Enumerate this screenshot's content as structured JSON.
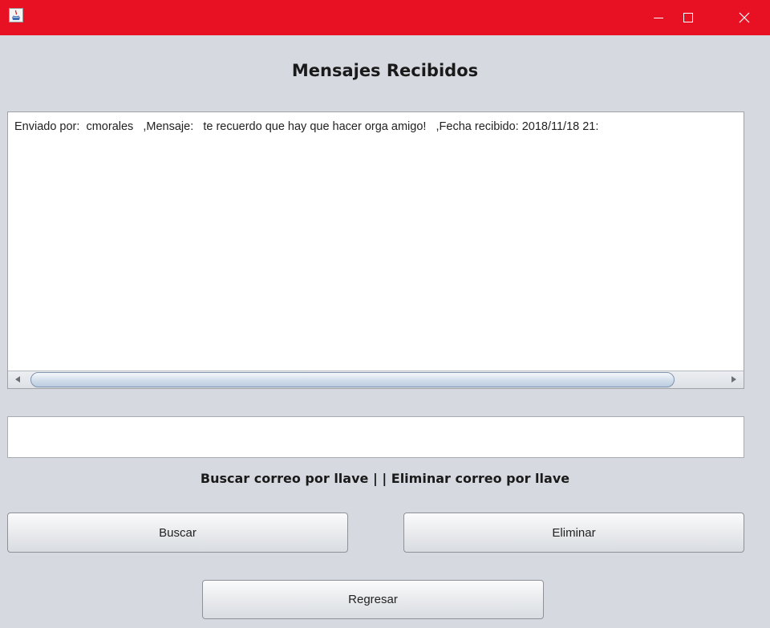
{
  "window": {
    "colors": {
      "titlebar": "#e81123",
      "background": "#d6d9df"
    },
    "icons": {
      "app": "java-icon",
      "minimize": "minimize-icon",
      "maximize": "maximize-icon",
      "close": "close-icon"
    }
  },
  "heading": "Mensajes Recibidos",
  "messages": {
    "lines": [
      "Enviado por:  cmorales   ,Mensaje:   te recuerdo que hay que hacer orga amigo!   ,Fecha recibido: 2018/11/18 21:"
    ]
  },
  "key_input": {
    "value": ""
  },
  "caption": "Buscar correo por llave | | Eliminar correo por llave",
  "buttons": {
    "buscar": "Buscar",
    "eliminar": "Eliminar",
    "regresar": "Regresar"
  }
}
